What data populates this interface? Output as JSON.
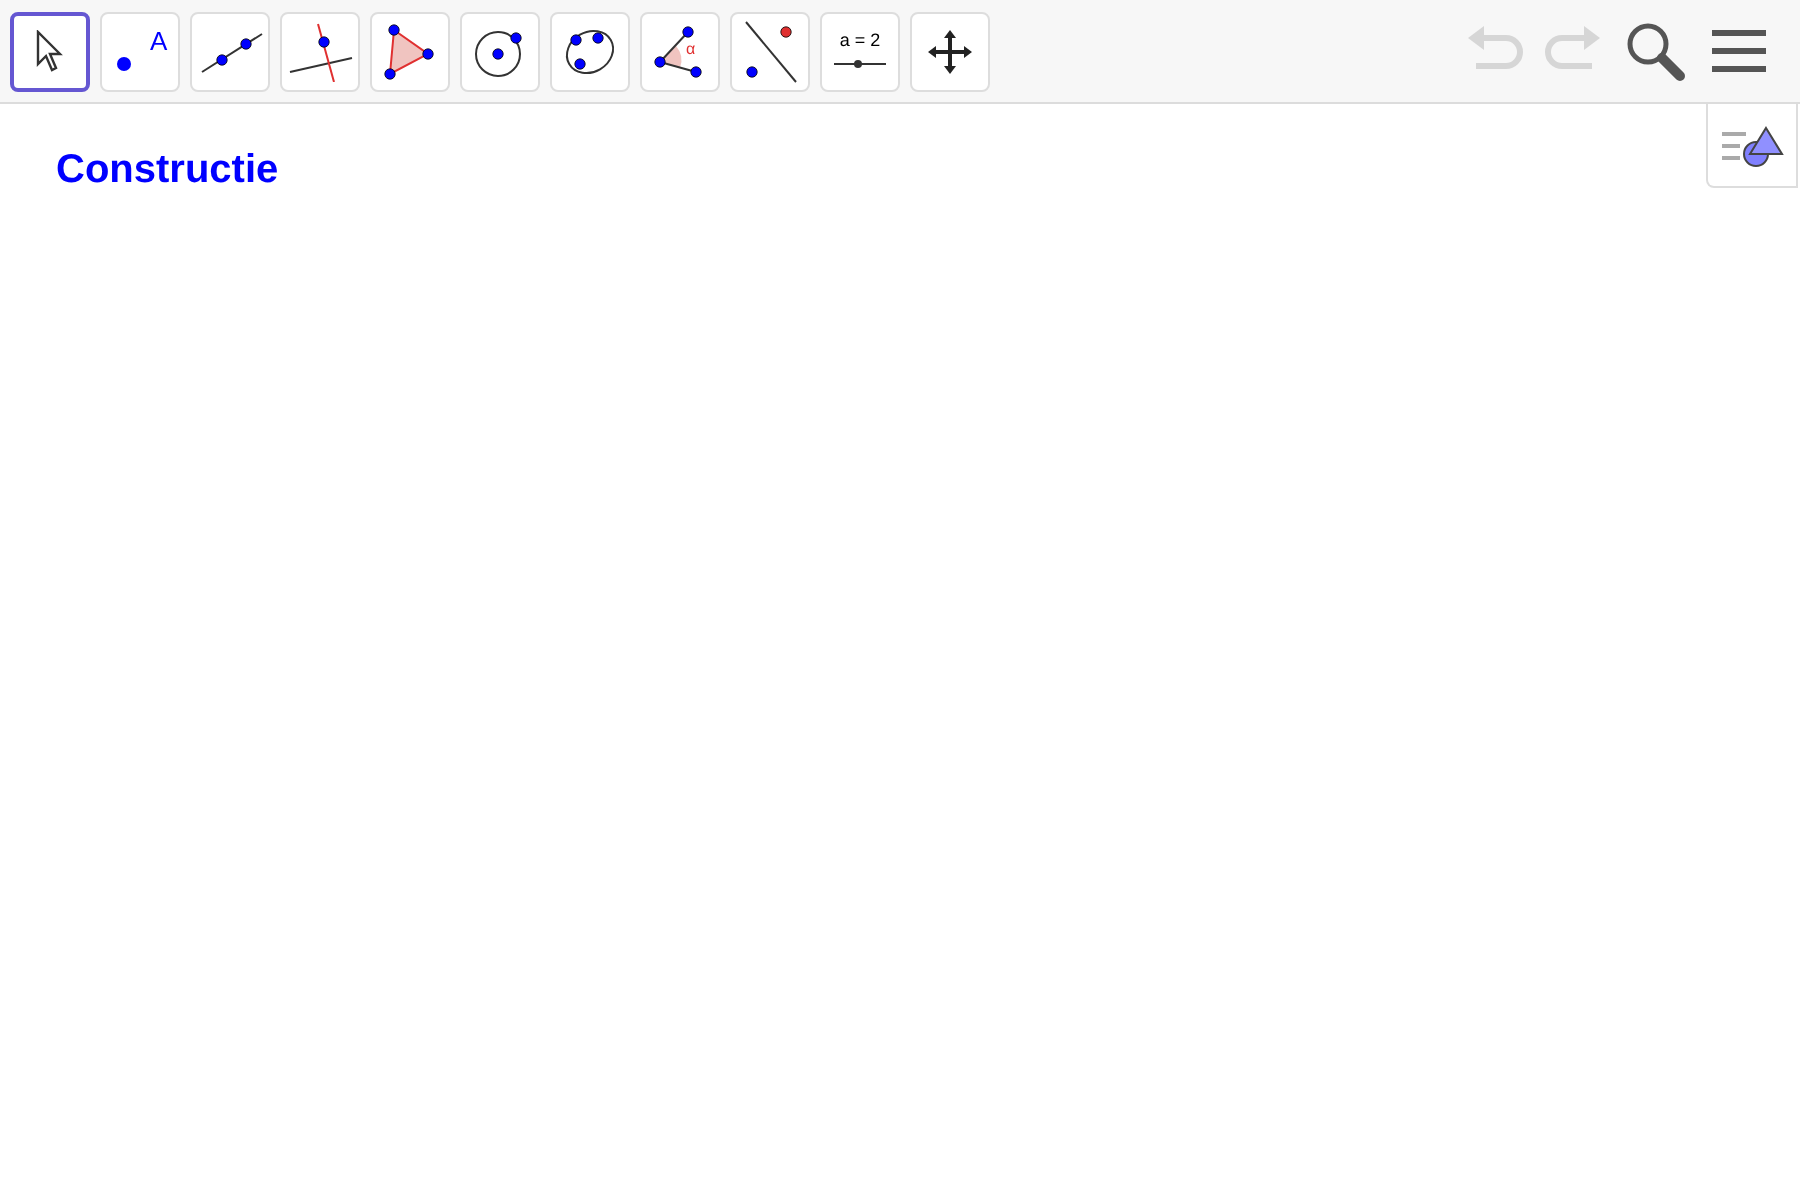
{
  "toolbar": {
    "tools": [
      {
        "kind": "move",
        "selected": true
      },
      {
        "kind": "point",
        "selected": false,
        "label": "A"
      },
      {
        "kind": "line",
        "selected": false
      },
      {
        "kind": "perpendicular",
        "selected": false
      },
      {
        "kind": "polygon",
        "selected": false
      },
      {
        "kind": "circle",
        "selected": false
      },
      {
        "kind": "conic",
        "selected": false
      },
      {
        "kind": "angle",
        "selected": false,
        "label": "α"
      },
      {
        "kind": "reflect",
        "selected": false
      },
      {
        "kind": "slider",
        "selected": false,
        "label": "a = 2"
      },
      {
        "kind": "pan",
        "selected": false
      }
    ],
    "undo": {
      "disabled": true
    },
    "redo": {
      "disabled": true
    }
  },
  "canvas": {
    "title": "Constructie"
  }
}
